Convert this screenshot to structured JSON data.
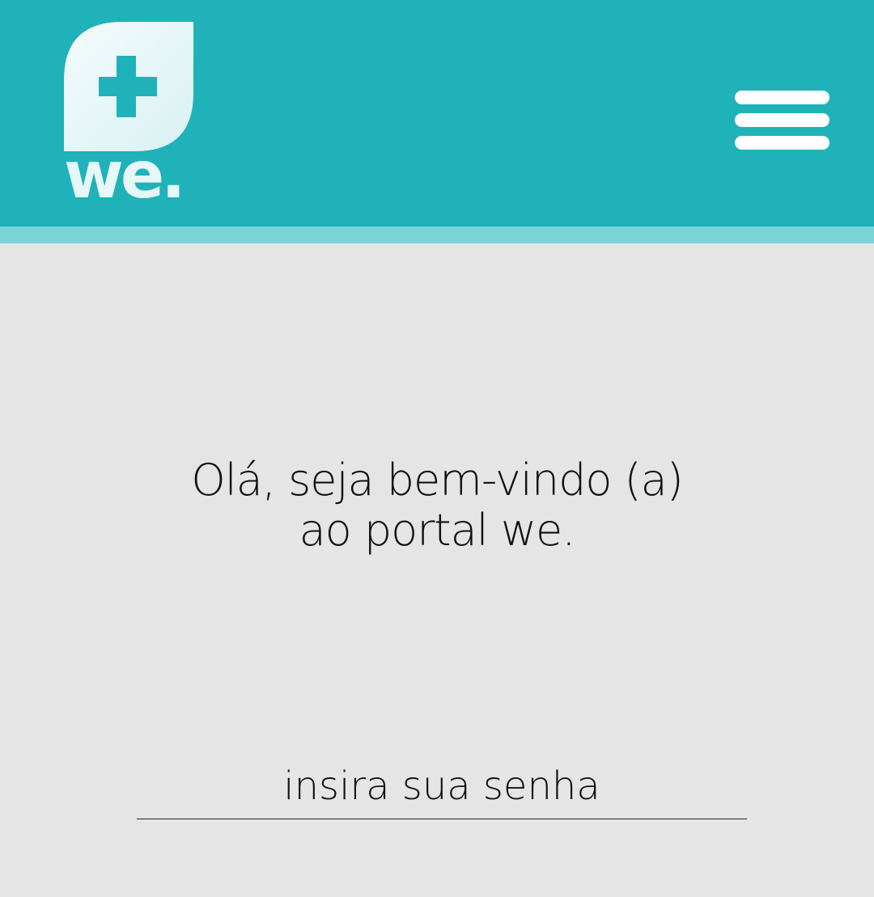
{
  "header": {
    "logo": {
      "icon": "plus-leaf-icon",
      "text": "we."
    },
    "menu_icon": "hamburger-menu-icon"
  },
  "main": {
    "welcome_line1": "Olá, seja bem-vindo (a)",
    "welcome_line2": "ao portal we.",
    "password_placeholder": "insira sua senha",
    "password_value": ""
  },
  "colors": {
    "header": "#20b2b9",
    "header_strip": "#79d3d7",
    "background": "#e5e5e5",
    "logo": "#e6f7f8"
  }
}
